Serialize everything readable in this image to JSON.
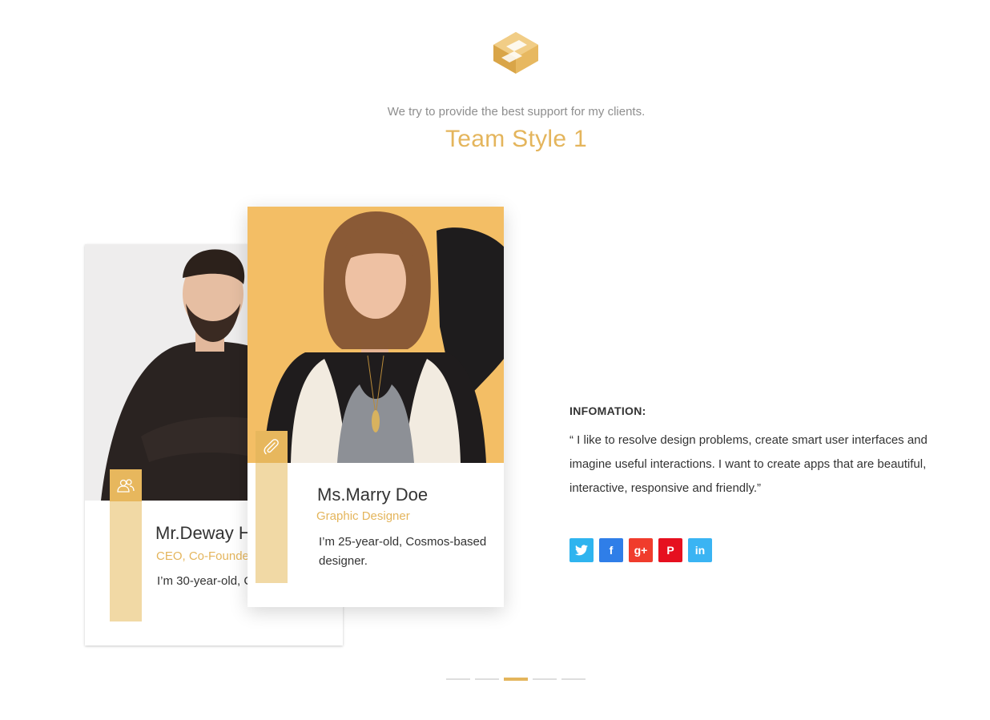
{
  "header": {
    "logo_icon": "stacked-s-logo-icon",
    "subtitle": "We try to provide the best support for my clients.",
    "title": "Team Style 1"
  },
  "accent_color": "#e4b55c",
  "team_cards": [
    {
      "name": "Mr.Deway H",
      "role": "CEO, Co-Founder",
      "description": "I’m 30-year-old, C CEO",
      "icon": "users-icon"
    },
    {
      "name": "Ms.Marry Doe",
      "role": "Graphic Designer",
      "description": "I’m 25-year-old, Cosmos-based designer.",
      "icon": "paperclip-icon"
    }
  ],
  "info": {
    "label": "INFOMATION:",
    "text": "“ I like to resolve design problems, create smart user interfaces and imagine useful interactions. I want to create apps that are beautiful, interactive, responsive and friendly.”"
  },
  "socials": [
    {
      "name": "twitter",
      "glyph": "twitter-icon",
      "color": "#2fb4ef"
    },
    {
      "name": "facebook",
      "glyph": "f",
      "color": "#2f7ee8"
    },
    {
      "name": "google-plus",
      "glyph": "g+",
      "color": "#f03c2c"
    },
    {
      "name": "pinterest",
      "glyph": "P",
      "color": "#e6101f"
    },
    {
      "name": "linkedin",
      "glyph": "in",
      "color": "#3ab4f3"
    }
  ],
  "carousel": {
    "total": 5,
    "active_index": 2
  }
}
